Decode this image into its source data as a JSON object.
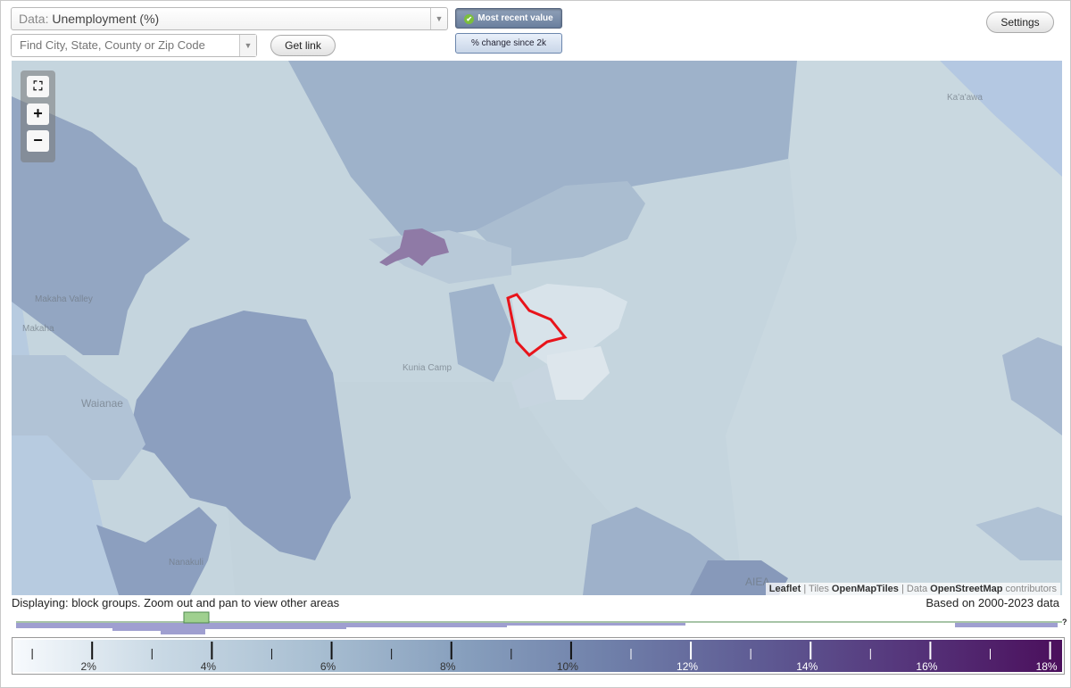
{
  "header": {
    "data_prefix": "Data:",
    "data_value": "Unemployment (%)",
    "search_placeholder": "Find City, State, County or Zip Code",
    "get_link_label": "Get link",
    "settings_label": "Settings",
    "toggle_active_label": "Most recent value",
    "toggle_inactive_label": "% change since 2k"
  },
  "map": {
    "place_labels": [
      "Makaha Valley",
      "Makaha",
      "Waianae",
      "Kunia Camp",
      "Nanakuli",
      "Ka'a'awa",
      "AIEA"
    ],
    "attribution": {
      "leaflet": "Leaflet",
      "sep1": " | Tiles ",
      "tiles": "OpenMapTiles",
      "sep2": " | Data ",
      "data_src": "OpenStreetMap",
      "suffix": " contributors"
    },
    "selected_outline_color": "#e8141b"
  },
  "status": {
    "displaying": "Displaying: block groups. Zoom out and pan to view other areas",
    "based_on": "Based on 2000-2023 data",
    "help": "?"
  },
  "legend": {
    "ticks": [
      "2%",
      "4%",
      "6%",
      "8%",
      "10%",
      "12%",
      "14%",
      "16%",
      "18%"
    ],
    "range": [
      0.7,
      18.2
    ],
    "colors": [
      "#f7fafd",
      "#c8d8e4",
      "#a9bfd2",
      "#879fbd",
      "#6f7fa9",
      "#5e5a93",
      "#55347a",
      "#4b0f5c"
    ],
    "histogram_highlight_color": "#9fd08f",
    "histogram_bar_color": "#9f9fd0"
  }
}
